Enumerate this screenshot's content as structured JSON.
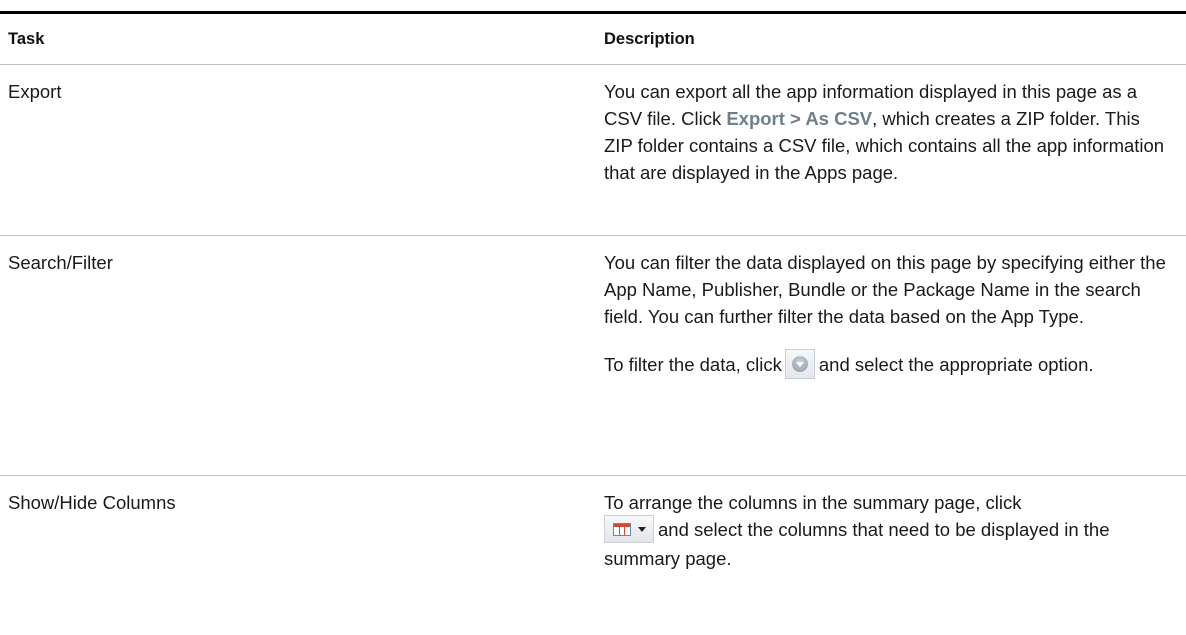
{
  "table": {
    "headers": {
      "task": "Task",
      "description": "Description"
    },
    "rows": [
      {
        "task": "Export",
        "desc_prefix": "You can export all the app information displayed in this page as a CSV file. Click ",
        "ui_reference": "Export > As CSV",
        "desc_suffix": ", which creates a ZIP folder. This ZIP folder contains a CSV file, which contains all the app information that are displayed in the Apps page."
      },
      {
        "task": "Search/Filter",
        "desc_para1": "You can filter the data displayed on this page by specifying either the App Name, Publisher, Bundle or the Package Name in the search field. You can further filter the data based on the App Type.",
        "desc_para2_prefix": "To filter the data, click",
        "desc_para2_icon": "filter-dropdown-icon",
        "desc_para2_suffix": "and select the appropriate option."
      },
      {
        "task": "Show/Hide Columns",
        "desc_prefix": "To arrange the columns in the summary page, click",
        "desc_icon": "show-hide-columns-icon",
        "desc_suffix": "and select the columns that need to be displayed in the summary page."
      }
    ]
  },
  "colors": {
    "ui_reference": "#6e7e8b",
    "top_rule": "#000000",
    "row_rule": "#bfbfbf"
  }
}
